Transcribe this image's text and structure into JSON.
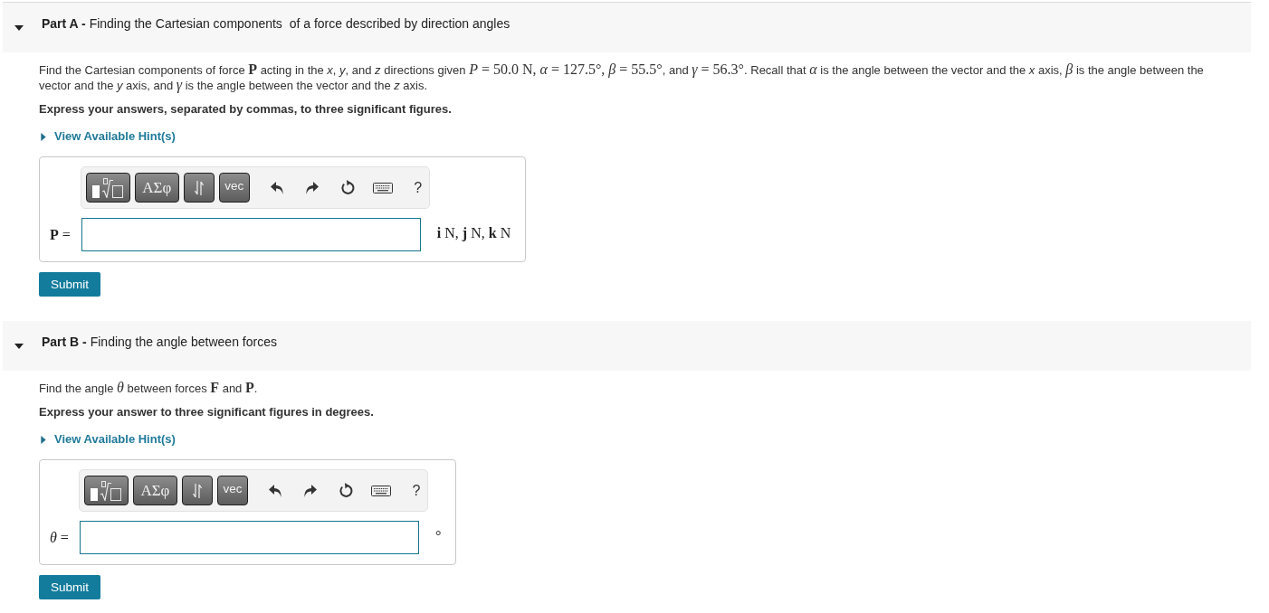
{
  "parts": [
    {
      "heading": "**Part A -** Finding the Cartesian components  of a force described by direction angles",
      "expanded": true,
      "prompt": [
        {
          "kind": "text",
          "text": "Find the Cartesian components of force "
        },
        {
          "kind": "math",
          "text": "**P**"
        },
        {
          "kind": "text",
          "text": " acting in the *x*, *y*, and *z* directions given "
        },
        {
          "kind": "math",
          "text": "*P* = 50.0 N, *α* = 127.5°, *β* = 55.5°"
        },
        {
          "kind": "text",
          "text": ", and "
        },
        {
          "kind": "math",
          "text": "*γ* = 56.3°"
        },
        {
          "kind": "text",
          "text": ". Recall that "
        },
        {
          "kind": "math",
          "text": "*α*"
        },
        {
          "kind": "text",
          "text": " is the angle between the vector and the *x* axis, "
        },
        {
          "kind": "math",
          "text": "*β*"
        },
        {
          "kind": "text",
          "text": " is the angle between the vector and the *y* axis, and "
        },
        {
          "kind": "math",
          "text": "*γ*"
        },
        {
          "kind": "text",
          "text": " is the angle between the vector and the *z* axis."
        }
      ],
      "instruction": "Express your answers, separated by commas, to three significant figures.",
      "hint": {
        "label": "View Available Hint(s)",
        "expanded": false
      },
      "toolbar": {
        "symbols": "ΑΣφ",
        "vector": "vec",
        "help": "?"
      },
      "answer": {
        "label": "**P** =",
        "units": "**i** N, **j** N, **k** N"
      },
      "submit": "Submit"
    },
    {
      "heading": "**Part B -** Finding the angle between forces",
      "expanded": true,
      "prompt": [
        {
          "kind": "text",
          "text": "Find the angle "
        },
        {
          "kind": "math",
          "text": "*θ*"
        },
        {
          "kind": "text",
          "text": " between forces "
        },
        {
          "kind": "math",
          "text": "**F**"
        },
        {
          "kind": "text",
          "text": " and "
        },
        {
          "kind": "math",
          "text": "**P**"
        },
        {
          "kind": "text",
          "text": "."
        }
      ],
      "instruction": "Express your answer to three significant figures in degrees.",
      "hint": {
        "label": "View Available Hint(s)",
        "expanded": false
      },
      "toolbar": {
        "symbols": "ΑΣφ",
        "vector": "vec",
        "help": "?"
      },
      "answer": {
        "label": "*θ* =",
        "units": "°"
      },
      "submit": "Submit"
    }
  ]
}
